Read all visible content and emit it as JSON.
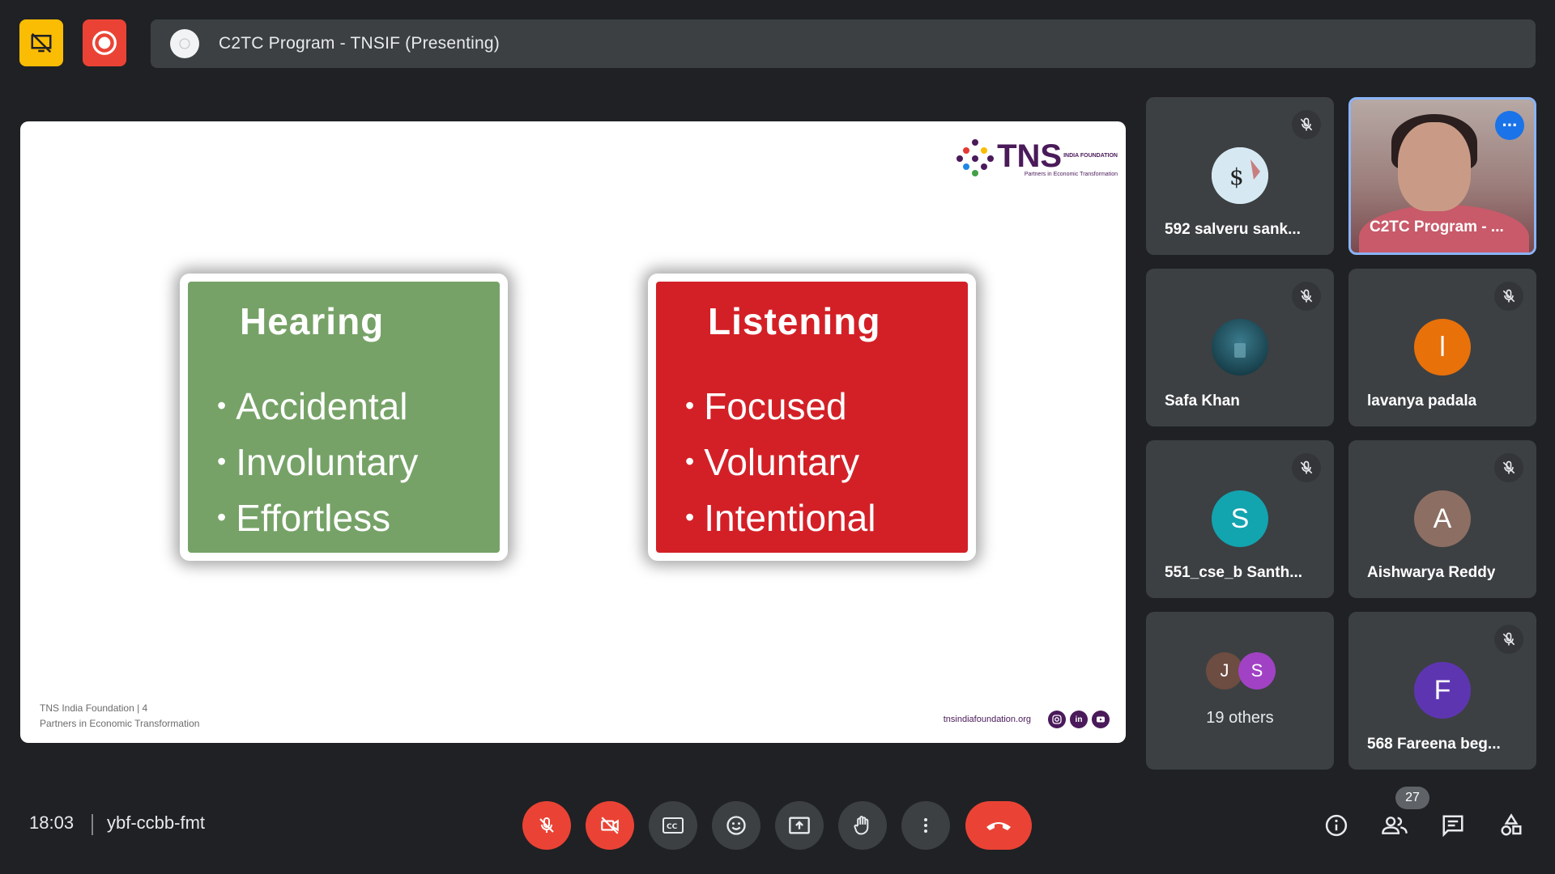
{
  "top_bar": {
    "presenting_title": "C2TC Program - TNSIF (Presenting)"
  },
  "slide": {
    "logo": {
      "brand": "TNS",
      "brand_sub": "INDIA FOUNDATION",
      "tagline": "Partners in Economic Transformation"
    },
    "cards": [
      {
        "heading": "Hearing",
        "bullets": [
          "Accidental",
          "Involuntary",
          "Effortless"
        ],
        "color": "#76a267"
      },
      {
        "heading": "Listening",
        "bullets": [
          "Focused",
          "Voluntary",
          "Intentional"
        ],
        "color": "#d32027"
      }
    ],
    "footer": {
      "line1": "TNS India Foundation | 4",
      "line2": "Partners in Economic Transformation",
      "website": "tnsindiafoundation.org",
      "social_icons": [
        "instagram-icon",
        "linkedin-icon",
        "youtube-icon"
      ]
    }
  },
  "participants": [
    {
      "name": "592 salveru sank...",
      "avatar_type": "image",
      "muted": true
    },
    {
      "name": "C2TC Program - ...",
      "avatar_type": "video",
      "muted": false,
      "active_speaker": true
    },
    {
      "name": "Safa Khan",
      "avatar_type": "image",
      "muted": true
    },
    {
      "name": "lavanya padala",
      "avatar_letter": "l",
      "avatar_color": "#e8710a",
      "muted": true
    },
    {
      "name": "551_cse_b Santh...",
      "avatar_letter": "S",
      "avatar_color": "#12a4af",
      "muted": true
    },
    {
      "name": "Aishwarya Reddy",
      "avatar_letter": "A",
      "avatar_color": "#8d6e63",
      "muted": true
    },
    {
      "name": "19 others",
      "mini_avatars": [
        {
          "letter": "J",
          "color": "#6d4c41"
        },
        {
          "letter": "S",
          "color": "#a142c4"
        }
      ]
    },
    {
      "name": "568 Fareena beg...",
      "avatar_letter": "F",
      "avatar_color": "#5e35b1",
      "muted": true
    }
  ],
  "bottom_bar": {
    "time": "18:03",
    "meeting_code": "ybf-ccbb-fmt",
    "participant_count": "27",
    "accent_red": "#ea4335"
  }
}
